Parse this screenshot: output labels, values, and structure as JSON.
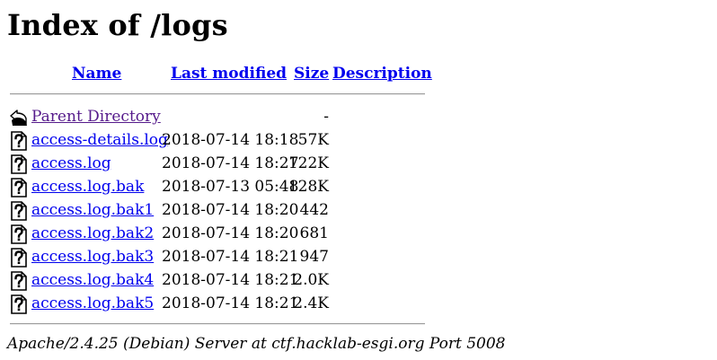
{
  "page": {
    "title": "Index of /logs"
  },
  "columns": {
    "name": "Name",
    "last_modified": "Last modified",
    "size": "Size",
    "description": "Description"
  },
  "rows": [
    {
      "icon": "back-icon",
      "name": "Parent Directory",
      "date": "",
      "size": "-",
      "description": ""
    },
    {
      "icon": "unknown-file-icon",
      "name": "access-details.log",
      "date": "2018-07-14 18:18",
      "size": "57K",
      "description": ""
    },
    {
      "icon": "unknown-file-icon",
      "name": "access.log",
      "date": "2018-07-14 18:27",
      "size": "122K",
      "description": ""
    },
    {
      "icon": "unknown-file-icon",
      "name": "access.log.bak",
      "date": "2018-07-13 05:48",
      "size": "128K",
      "description": ""
    },
    {
      "icon": "unknown-file-icon",
      "name": "access.log.bak1",
      "date": "2018-07-14 18:20",
      "size": "442",
      "description": ""
    },
    {
      "icon": "unknown-file-icon",
      "name": "access.log.bak2",
      "date": "2018-07-14 18:20",
      "size": "681",
      "description": ""
    },
    {
      "icon": "unknown-file-icon",
      "name": "access.log.bak3",
      "date": "2018-07-14 18:21",
      "size": "947",
      "description": ""
    },
    {
      "icon": "unknown-file-icon",
      "name": "access.log.bak4",
      "date": "2018-07-14 18:21",
      "size": "2.0K",
      "description": ""
    },
    {
      "icon": "unknown-file-icon",
      "name": "access.log.bak5",
      "date": "2018-07-14 18:21",
      "size": "2.4K",
      "description": ""
    }
  ],
  "footer": {
    "server": "Apache/2.4.25 (Debian) Server at ctf.hacklab-esgi.org Port 5008"
  },
  "colors": {
    "link": "#0000ee",
    "visited_link": "#551a8b",
    "text": "#000000",
    "background": "#ffffff"
  }
}
